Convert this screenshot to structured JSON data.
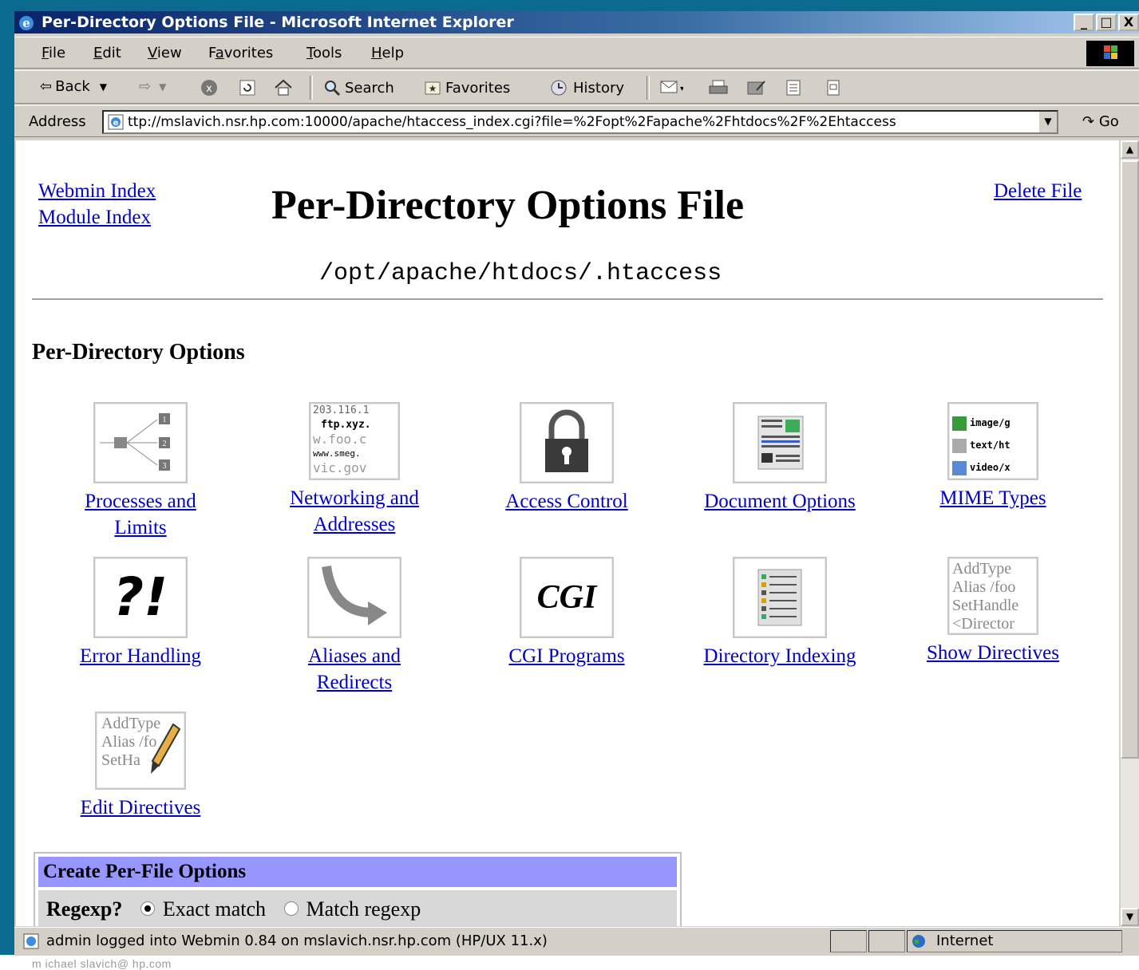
{
  "window": {
    "title": "Per-Directory Options File - Microsoft Internet Explorer",
    "controls": [
      "_",
      "□",
      "X"
    ]
  },
  "menu": {
    "items": [
      {
        "u": "F",
        "rest": "ile"
      },
      {
        "u": "E",
        "rest": "dit"
      },
      {
        "u": "V",
        "rest": "iew"
      },
      {
        "pre": "F",
        "u": "a",
        "rest": "vorites"
      },
      {
        "u": "T",
        "rest": "ools"
      },
      {
        "u": "H",
        "rest": "elp"
      }
    ]
  },
  "toolbar": {
    "back": "Back",
    "search": "Search",
    "favorites": "Favorites",
    "history": "History"
  },
  "address": {
    "label": "Address",
    "url": "ttp://mslavich.nsr.hp.com:10000/apache/htaccess_index.cgi?file=%2Fopt%2Fapache%2Fhtdocs%2F%2Ehtaccess",
    "go": "Go"
  },
  "page": {
    "webmin_index": "Webmin Index",
    "module_index": "Module Index",
    "delete_file": "Delete File",
    "title": "Per-Directory Options File",
    "filepath": "/opt/apache/htdocs/.htaccess",
    "section_title": "Per-Directory Options",
    "options": [
      {
        "line1": "Processes and",
        "line2": "Limits",
        "icon": "process-tree-icon"
      },
      {
        "line1": "Networking and",
        "line2": "Addresses",
        "icon": "network-addresses-icon"
      },
      {
        "line1": "Access Control",
        "line2": "",
        "icon": "padlock-icon"
      },
      {
        "line1": "Document Options",
        "line2": "",
        "icon": "document-icon"
      },
      {
        "line1": "MIME Types",
        "line2": "",
        "icon": "mime-types-icon"
      },
      {
        "line1": "Error Handling",
        "line2": "",
        "icon": "error-icon"
      },
      {
        "line1": "Aliases and",
        "line2": "Redirects",
        "icon": "redirect-arrow-icon"
      },
      {
        "line1": "CGI Programs",
        "line2": "",
        "icon": "cgi-icon"
      },
      {
        "line1": "Directory Indexing",
        "line2": "",
        "icon": "directory-listing-icon"
      },
      {
        "line1": "Show Directives",
        "line2": "",
        "icon": "directives-text-icon"
      },
      {
        "line1": "Edit Directives",
        "line2": "",
        "icon": "edit-directives-icon"
      }
    ],
    "icon_text": {
      "network": [
        "203.116.1",
        "ftp.xyz.",
        "w.foo.c",
        "www.smeg.",
        "vic.gov"
      ],
      "mime": [
        "image/g",
        "text/ht",
        "video/x"
      ],
      "cgi": "CGI",
      "error": "?!",
      "show_dir": [
        "AddType",
        "Alias /foo",
        "SetHandle",
        "<Director"
      ],
      "edit_dir": [
        "AddType",
        "Alias /fo",
        "SetHa"
      ]
    },
    "create": {
      "header": "Create Per-File Options",
      "regexp_label": "Regexp?",
      "exact": "Exact match",
      "regexp": "Match regexp",
      "selected": "exact"
    }
  },
  "status": {
    "text": "admin logged into Webmin 0.84 on mslavich.nsr.hp.com (HP/UX 11.x)",
    "zone": "Internet"
  },
  "caption": "m ichael slavich@ hp.com"
}
